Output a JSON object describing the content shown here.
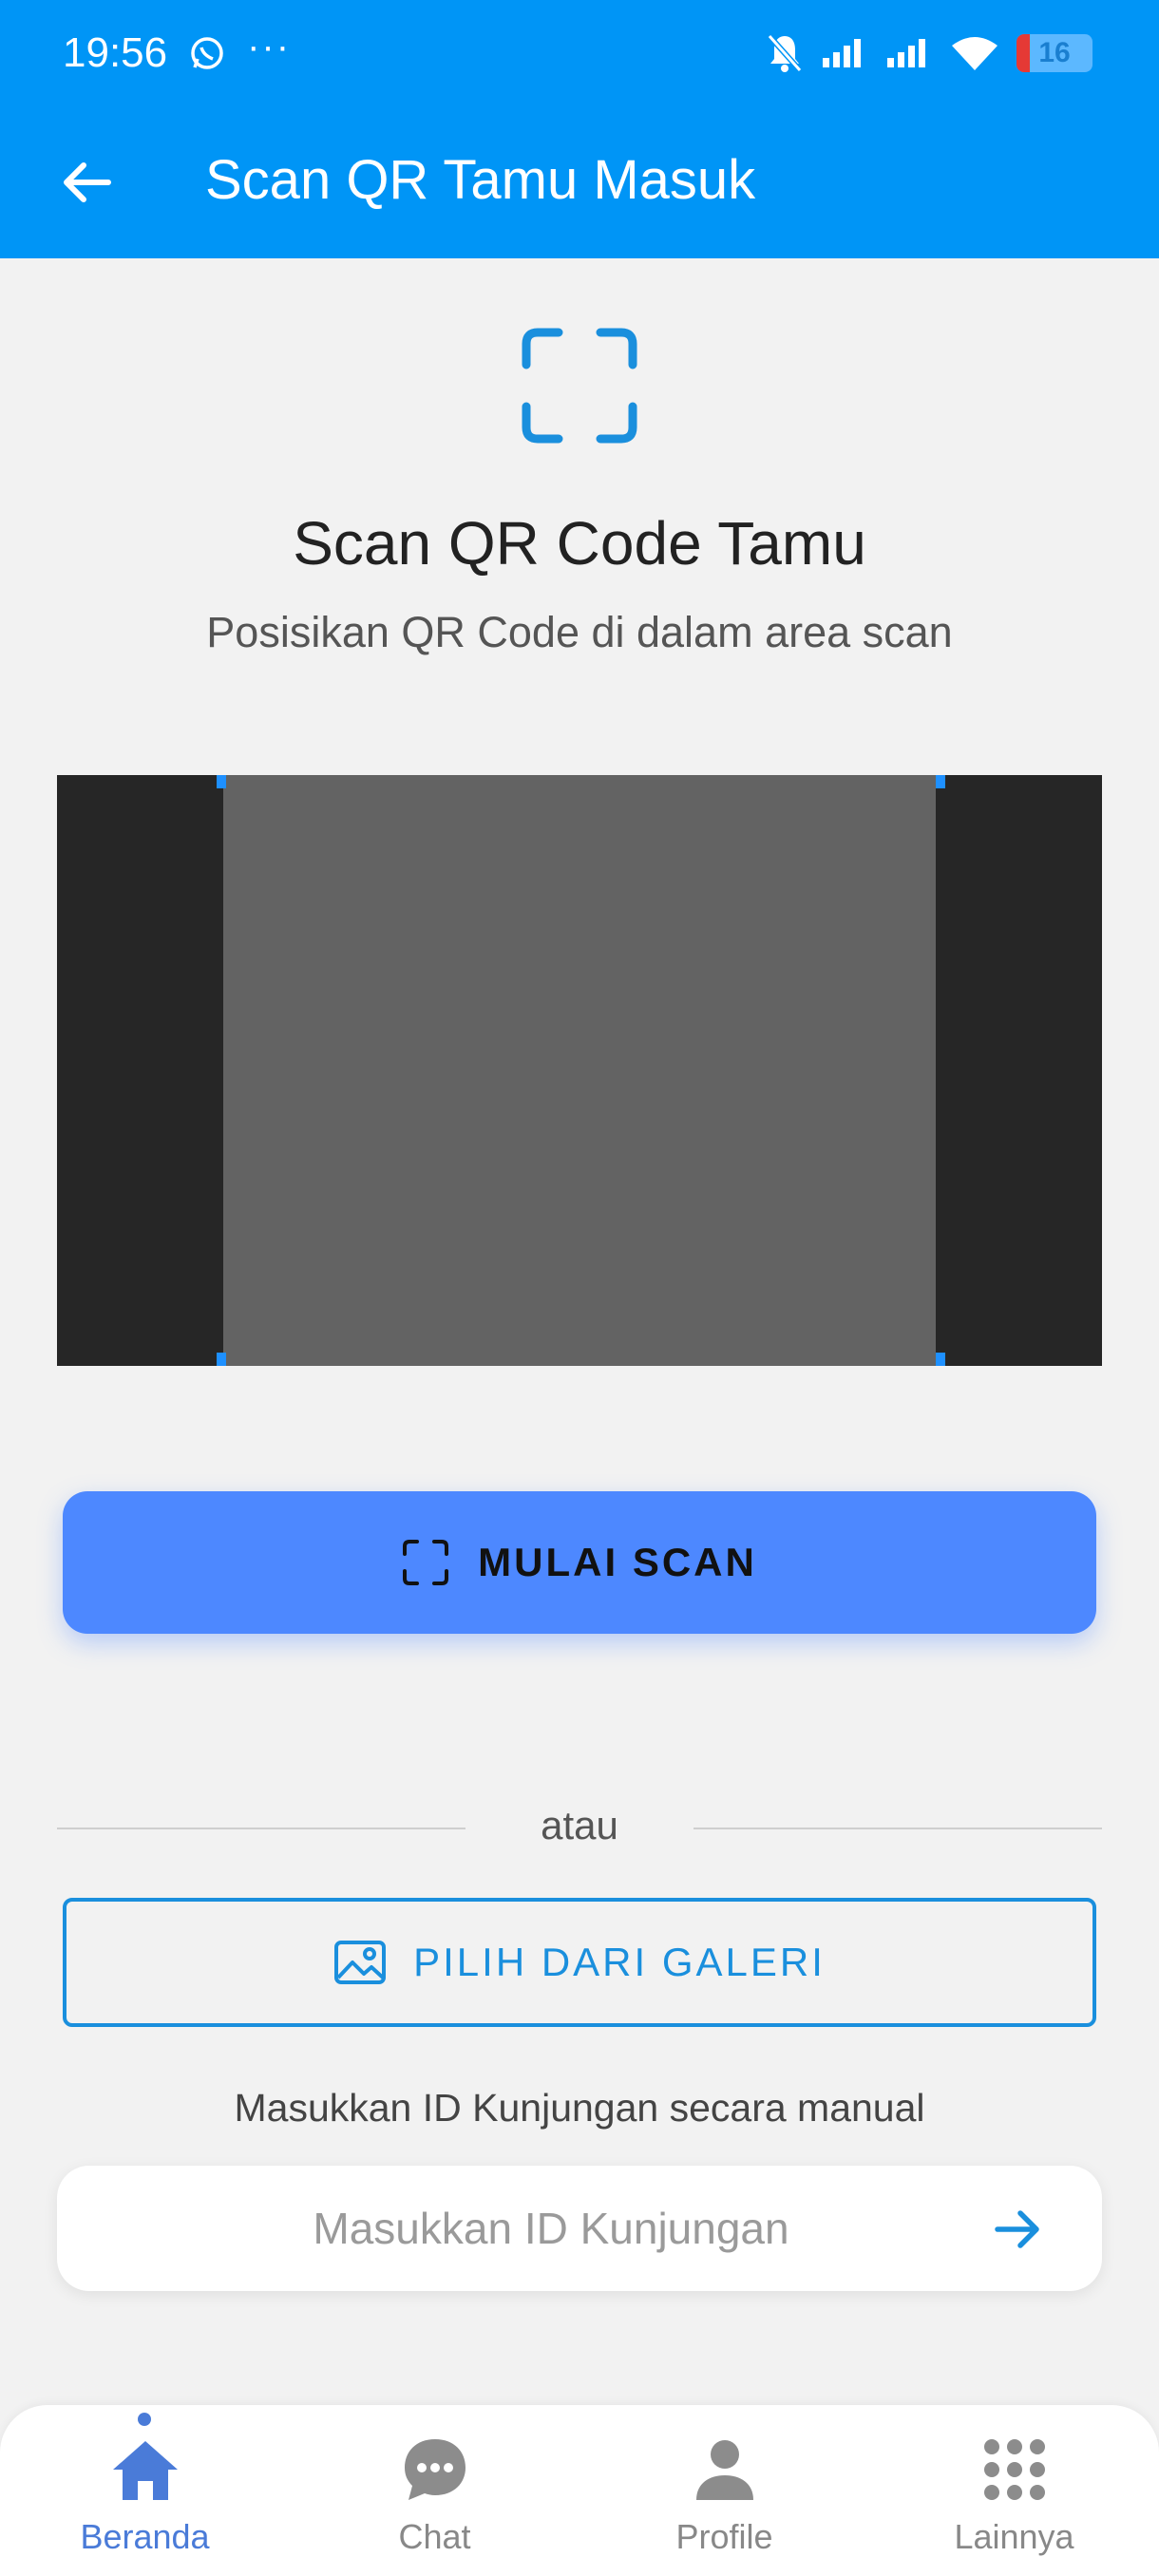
{
  "status_bar": {
    "time": "19:56",
    "dots": "···",
    "battery": "16"
  },
  "app_bar": {
    "title": "Scan QR Tamu Masuk"
  },
  "hero": {
    "title": "Scan QR Code Tamu",
    "subtitle": "Posisikan QR Code di dalam area scan"
  },
  "actions": {
    "scan_label": "MULAI SCAN",
    "divider_text": "atau",
    "gallery_label": "PILIH DARI GALERI"
  },
  "manual": {
    "label": "Masukkan ID Kunjungan secara manual",
    "placeholder": "Masukkan ID Kunjungan",
    "value": ""
  },
  "bottom_nav": {
    "items": [
      {
        "label": "Beranda",
        "icon": "home-icon",
        "active": true
      },
      {
        "label": "Chat",
        "icon": "chat-icon",
        "active": false
      },
      {
        "label": "Profile",
        "icon": "profile-icon",
        "active": false
      },
      {
        "label": "Lainnya",
        "icon": "grid-icon",
        "active": false
      }
    ]
  },
  "colors": {
    "primary": "#0095f6",
    "scan_button": "#4d88ff",
    "gallery_border": "#1a8fdd",
    "nav_active": "#4a7bd8"
  }
}
